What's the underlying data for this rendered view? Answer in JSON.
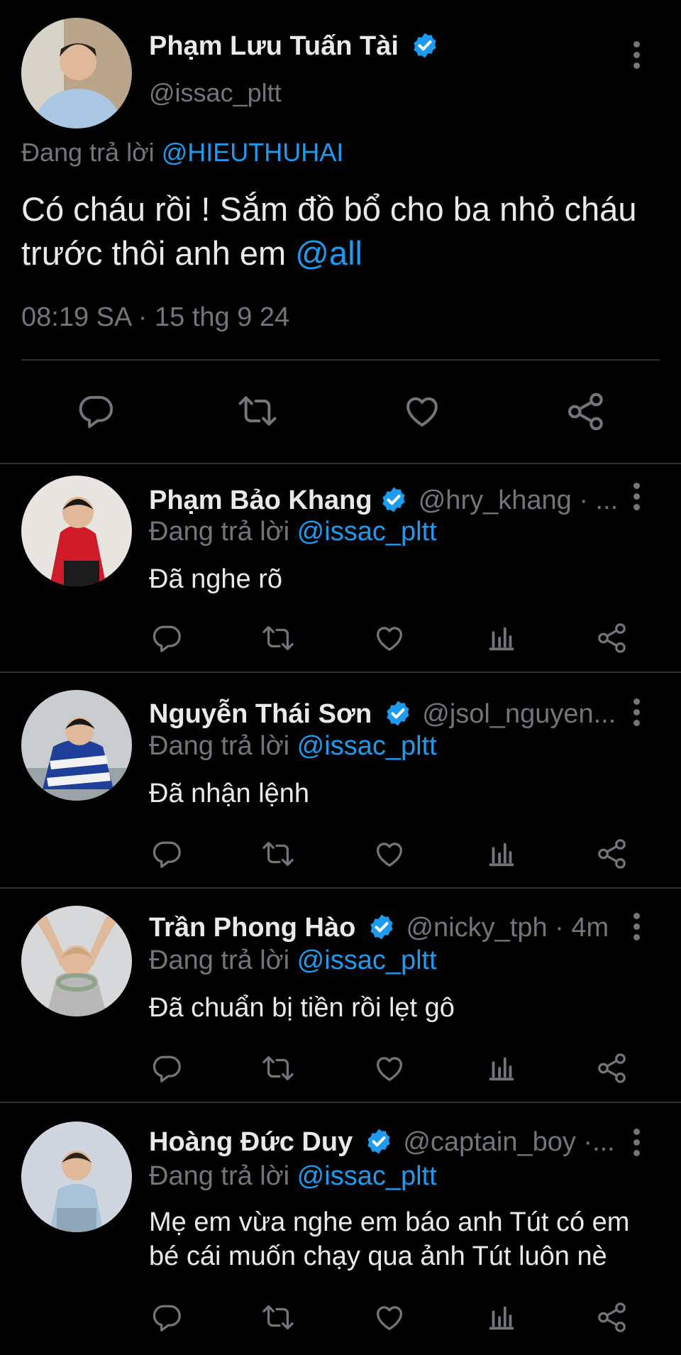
{
  "colors": {
    "background": "#000000",
    "text": "#e7e9ea",
    "muted": "#71767b",
    "accent": "#1d9bf0",
    "divider": "#2f3336"
  },
  "main": {
    "author_name": "Phạm Lưu Tuấn Tài",
    "author_handle": "@issac_pltt",
    "replying_prefix": "Đang trả lời",
    "replying_to": "@HIEUTHUHAI",
    "text_part1": "Có cháu rồi ! Sắm đồ bổ cho ba nhỏ cháu trước thôi anh em",
    "mention": "@all",
    "timestamp": "08:19 SA · 15 thg 9 24",
    "actions": [
      "reply-icon",
      "retweet-icon",
      "like-icon",
      "share-icon"
    ]
  },
  "replies": [
    {
      "name": "Phạm Bảo Khang",
      "meta": "@hry_khang · ...",
      "replying_prefix": "Đang trả lời",
      "replying_to": "@issac_pltt",
      "text": "Đã nghe rõ"
    },
    {
      "name": "Nguyễn Thái Sơn",
      "meta": "@jsol_nguyen...",
      "replying_prefix": "Đang trả lời",
      "replying_to": "@issac_pltt",
      "text": "Đã nhận lệnh"
    },
    {
      "name": "Trần Phong Hào",
      "meta": "@nicky_tph · 4m",
      "replying_prefix": "Đang trả lời",
      "replying_to": "@issac_pltt",
      "text": "Đã chuẩn bị tiền rồi lẹt gô"
    },
    {
      "name": "Hoàng Đức Duy",
      "meta": "@captain_boy ·...",
      "replying_prefix": "Đang trả lời",
      "replying_to": "@issac_pltt",
      "text": "Mẹ em vừa nghe em báo anh Tút có em bé cái muốn chạy qua ảnh Tút luôn nè"
    }
  ]
}
